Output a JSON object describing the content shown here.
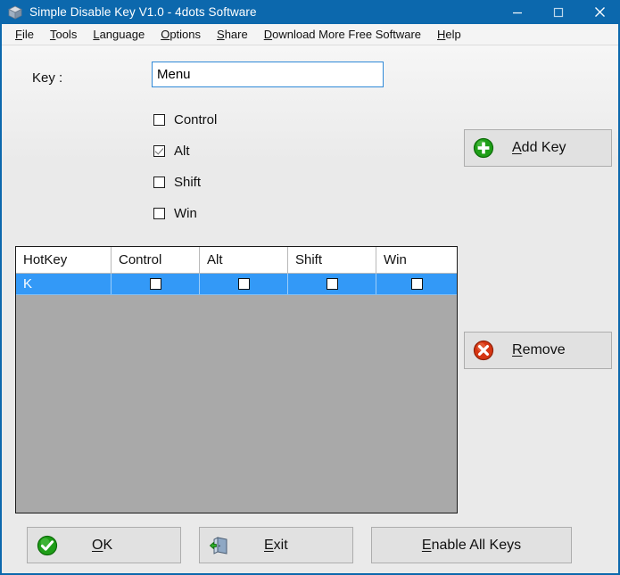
{
  "window": {
    "title": "Simple Disable Key V1.0 - 4dots Software",
    "icon": "box-icon",
    "controls": [
      {
        "name": "minimize-button",
        "glyph": "minimize-icon"
      },
      {
        "name": "maximize-button",
        "glyph": "maximize-icon"
      },
      {
        "name": "close-button",
        "glyph": "close-icon"
      }
    ],
    "titlebar_color": "#0c68ad",
    "background_color": "#eaeaea"
  },
  "menubar": {
    "items": [
      {
        "label": "File",
        "accel": "F"
      },
      {
        "label": "Tools",
        "accel": "T"
      },
      {
        "label": "Language",
        "accel": "L"
      },
      {
        "label": "Options",
        "accel": "O"
      },
      {
        "label": "Share",
        "accel": "S"
      },
      {
        "label": "Download More Free Software",
        "accel": "D"
      },
      {
        "label": "Help",
        "accel": "H"
      }
    ]
  },
  "form": {
    "key_label": "Key :",
    "key_value": "Menu",
    "key_placeholder": "",
    "modifiers": [
      {
        "label": "Control",
        "checked": false
      },
      {
        "label": "Alt",
        "checked": true
      },
      {
        "label": "Shift",
        "checked": false
      },
      {
        "label": "Win",
        "checked": false
      }
    ]
  },
  "side_buttons": {
    "add": {
      "label": "Add Key",
      "accel": "A",
      "icon": "green-plus-icon"
    },
    "remove": {
      "label": "Remove",
      "accel": "R",
      "icon": "red-x-icon"
    }
  },
  "grid": {
    "columns": [
      "HotKey",
      "Control",
      "Alt",
      "Shift",
      "Win"
    ],
    "rows": [
      {
        "hotkey": "K",
        "control": false,
        "alt": false,
        "shift": false,
        "win": false,
        "selected": true
      }
    ],
    "selection_color": "#3399f7",
    "body_color": "#a9a9a9"
  },
  "bottom_buttons": [
    {
      "label": "OK",
      "accel": "O",
      "icon": "green-check-icon",
      "name": "ok-button"
    },
    {
      "label": "Exit",
      "accel": "E",
      "icon": "exit-door-icon",
      "name": "exit-button"
    },
    {
      "label": "Enable All Keys",
      "accel": "E",
      "icon": "",
      "name": "enable-all-keys-button"
    }
  ]
}
